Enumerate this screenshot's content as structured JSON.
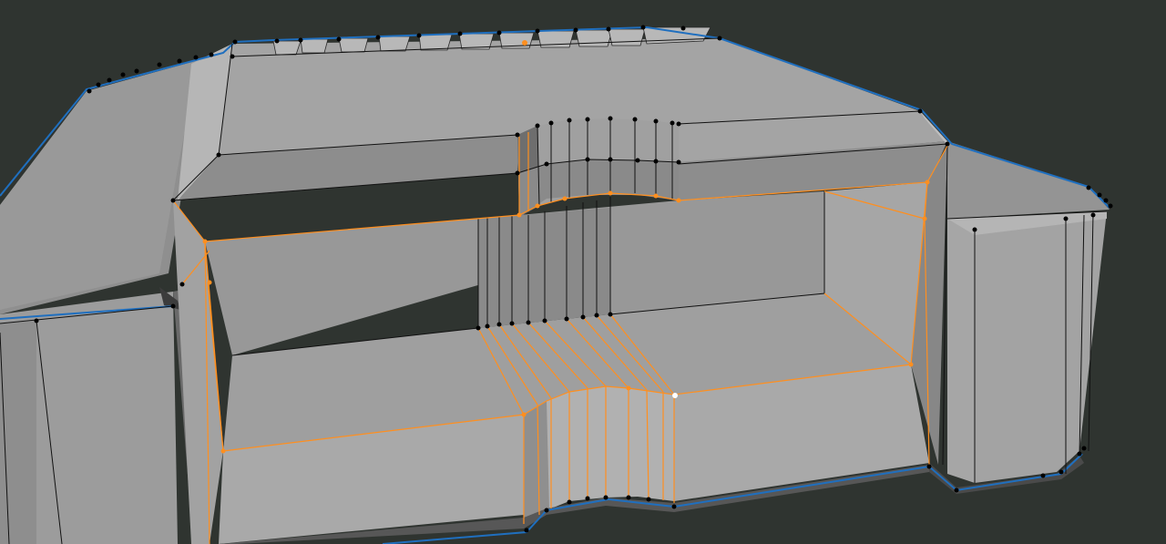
{
  "viewport": {
    "background": "#2f3430",
    "mesh_face_light": "#a8a8a8",
    "mesh_face_mid": "#9a9a9a",
    "mesh_face_dark": "#7e7e7e",
    "mesh_face_shadow": "#5f5f5f",
    "edge_color": "#000000",
    "selected_edge_color": "#ff8f1f",
    "active_vertex_color": "#ffffff",
    "outline_color": "#1f6fbf"
  }
}
